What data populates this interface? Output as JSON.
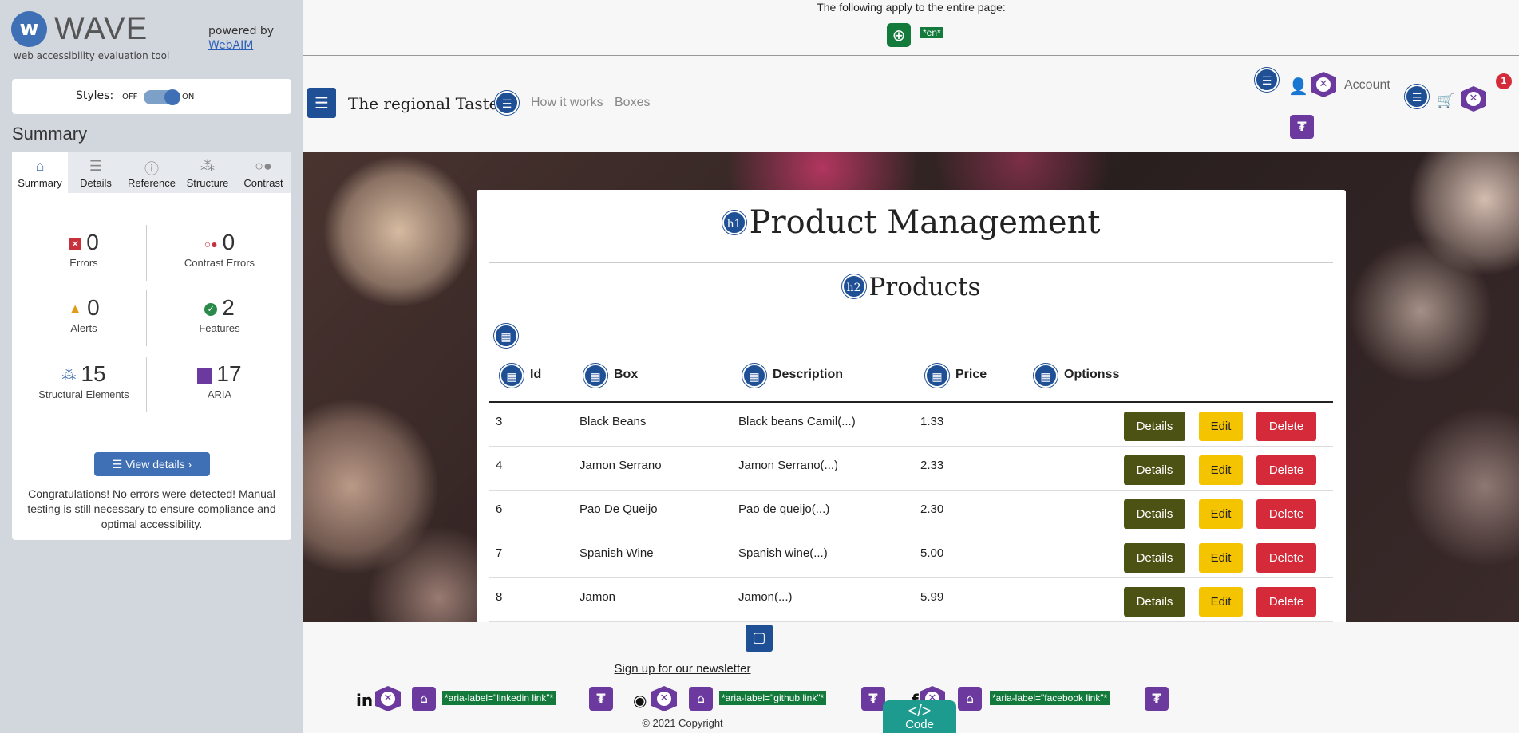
{
  "wave": {
    "title": "WAVE",
    "subtitle": "web accessibility evaluation tool",
    "powered_by": "powered by",
    "webaim": "WebAIM",
    "styles_label": "Styles:",
    "off": "OFF",
    "on": "ON",
    "summary_heading": "Summary",
    "tabs": [
      "Summary",
      "Details",
      "Reference",
      "Structure",
      "Contrast"
    ],
    "stats": {
      "errors": {
        "num": "0",
        "label": "Errors"
      },
      "contrast": {
        "num": "0",
        "label": "Contrast Errors"
      },
      "alerts": {
        "num": "0",
        "label": "Alerts"
      },
      "features": {
        "num": "2",
        "label": "Features"
      },
      "structural": {
        "num": "15",
        "label": "Structural Elements"
      },
      "aria": {
        "num": "17",
        "label": "ARIA"
      }
    },
    "view_details": "View details ›",
    "congrats": "Congratulations! No errors were detected! Manual testing is still necessary to ensure compliance and optimal accessibility."
  },
  "page": {
    "lang_note": "The following apply to the entire page:",
    "lang_tag": "*en*",
    "brand": "The regional Taste",
    "nav": [
      "How it works",
      "Boxes"
    ],
    "account": "Account",
    "cart_count": "1",
    "h1": "Product Management",
    "h2": "Products",
    "columns": [
      "Id",
      "Box",
      "Description",
      "Price",
      "Optionss"
    ],
    "rows": [
      {
        "id": "3",
        "box": "Black Beans",
        "desc": "Black beans Camil(...)",
        "price": "1.33"
      },
      {
        "id": "4",
        "box": "Jamon Serrano",
        "desc": "Jamon Serrano(...)",
        "price": "2.33"
      },
      {
        "id": "6",
        "box": "Pao De Queijo",
        "desc": "Pao de queijo(...)",
        "price": "2.30"
      },
      {
        "id": "7",
        "box": "Spanish Wine",
        "desc": "Spanish wine(...)",
        "price": "5.00"
      },
      {
        "id": "8",
        "box": "Jamon",
        "desc": "Jamon(...)",
        "price": "5.99"
      }
    ],
    "buttons": {
      "details": "Details",
      "edit": "Edit",
      "delete": "Delete"
    },
    "newsletter": "Sign up for our newsletter",
    "aria_linkedin": "*aria-label=\"linkedin link\"*",
    "aria_github": "*aria-label=\"github link\"*",
    "aria_facebook": "*aria-label=\"facebook link\"*",
    "copyright": "© 2021 Copyright",
    "code_btn": "Code",
    "code_glyph": "</>"
  }
}
